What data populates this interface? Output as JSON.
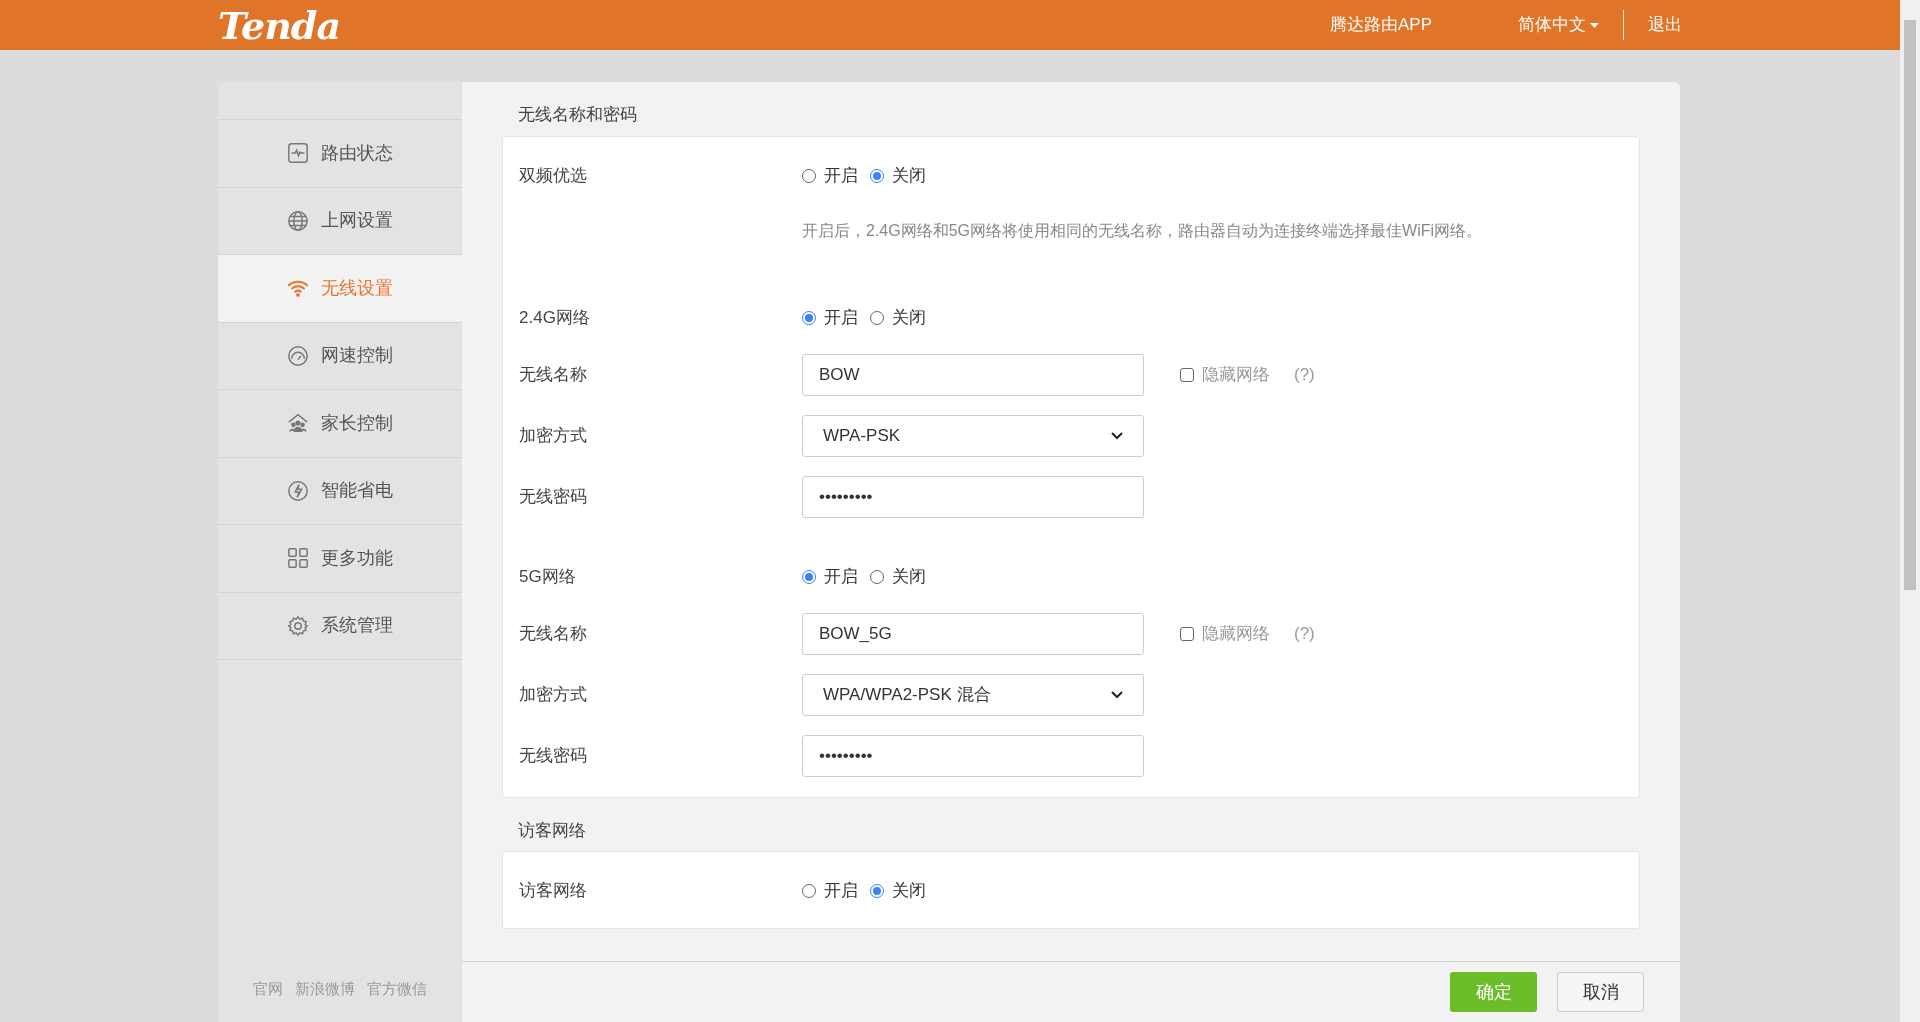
{
  "header": {
    "logo": "Tenda",
    "links": [
      {
        "label": "腾达路由APP",
        "kind": "link"
      },
      {
        "label": "简体中文",
        "kind": "dropdown"
      },
      {
        "label": "退出",
        "kind": "link"
      }
    ]
  },
  "sidebar": {
    "items": [
      {
        "label": "路由状态",
        "selected": false
      },
      {
        "label": "上网设置",
        "selected": false
      },
      {
        "label": "无线设置",
        "selected": true
      },
      {
        "label": "网速控制",
        "selected": false
      },
      {
        "label": "家长控制",
        "selected": false
      },
      {
        "label": "智能省电",
        "selected": false
      },
      {
        "label": "更多功能",
        "selected": false
      },
      {
        "label": "系统管理",
        "selected": false
      }
    ],
    "footer_links": [
      "官网",
      "新浪微博",
      "官方微信"
    ]
  },
  "sections": [
    {
      "title": "无线名称和密码",
      "rows": [
        {
          "kind": "radio",
          "label": "双频优选",
          "options": [
            {
              "label": "开启",
              "selected": false
            },
            {
              "label": "关闭",
              "selected": true
            }
          ],
          "hint": "开启后，2.4G网络和5G网络将使用相同的无线名称，路由器自动为连接终端选择最佳WiFi网络。"
        },
        {
          "kind": "radio",
          "label": "2.4G网络",
          "options": [
            {
              "label": "开启",
              "selected": true
            },
            {
              "label": "关闭",
              "selected": false
            }
          ]
        },
        {
          "kind": "text",
          "label": "无线名称",
          "value": "BOW",
          "checkbox": {
            "label": "隐藏网络",
            "checked": false,
            "help": "(?)"
          }
        },
        {
          "kind": "select",
          "label": "加密方式",
          "value": "WPA-PSK"
        },
        {
          "kind": "password",
          "label": "无线密码",
          "value": "•••••••••"
        },
        {
          "kind": "radio",
          "label": "5G网络",
          "options": [
            {
              "label": "开启",
              "selected": true
            },
            {
              "label": "关闭",
              "selected": false
            }
          ]
        },
        {
          "kind": "text",
          "label": "无线名称",
          "value": "BOW_5G",
          "checkbox": {
            "label": "隐藏网络",
            "checked": false,
            "help": "(?)"
          }
        },
        {
          "kind": "select",
          "label": "加密方式",
          "value": "WPA/WPA2-PSK 混合"
        },
        {
          "kind": "password",
          "label": "无线密码",
          "value": "•••••••••"
        }
      ]
    },
    {
      "title": "访客网络",
      "rows": [
        {
          "kind": "radio",
          "label": "访客网络",
          "options": [
            {
              "label": "开启",
              "selected": false
            },
            {
              "label": "关闭",
              "selected": true
            }
          ]
        }
      ]
    }
  ],
  "buttons": [
    {
      "label": "确定",
      "kind": "primary"
    },
    {
      "label": "取消",
      "kind": "secondary"
    }
  ]
}
